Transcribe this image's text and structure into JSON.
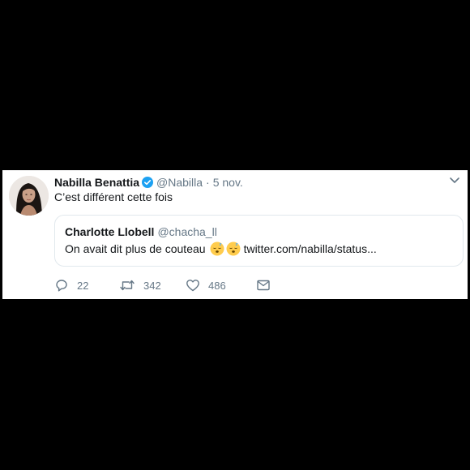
{
  "tweet": {
    "author": {
      "name": "Nabilla Benattia",
      "handle": "@Nabilla",
      "verified": true
    },
    "separator": "·",
    "date": "5 nov.",
    "text": "C’est différent cette fois",
    "quoted": {
      "author_name": "Charlotte Llobell",
      "author_handle": "@chacha_ll",
      "text": "On avait dit plus de couteau",
      "emojis": [
        "sleeping-face-icon",
        "sleeping-face-icon"
      ],
      "link": "twitter.com/nabilla/status..."
    },
    "actions": {
      "replies": "22",
      "retweets": "342",
      "likes": "486"
    }
  },
  "colors": {
    "page_background": "#000000",
    "card_background": "#ffffff",
    "verified_blue": "#1da1f2",
    "secondary_text": "#657786",
    "primary_text": "#14171a",
    "quote_border": "#e1e8ed"
  }
}
